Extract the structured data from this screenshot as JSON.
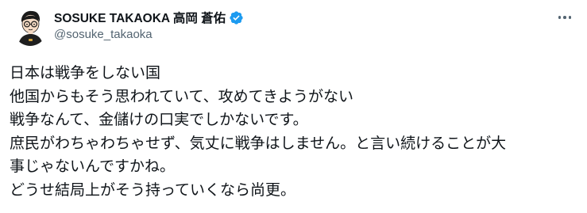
{
  "author": {
    "display_name": "SOSUKE TAKAOKA 高岡 蒼佑",
    "handle": "@sosuke_takaoka",
    "verified": true,
    "verified_color": "#1d9bf0"
  },
  "more_icon": "more-horizontal-icon",
  "post": {
    "lines": [
      "日本は戦争をしない国",
      "他国からもそう思われていて、攻めてきようがない",
      "戦争なんて、金儲けの口実でしかないです。",
      "庶民がわちゃわちゃせず、気丈に戦争はしません。と言い続けることが大",
      "事じゃないんですかね。",
      "どうせ結局上がそう持っていくなら尚更。"
    ]
  },
  "colors": {
    "text": "#0f1419",
    "secondary": "#536471",
    "background": "#ffffff"
  }
}
